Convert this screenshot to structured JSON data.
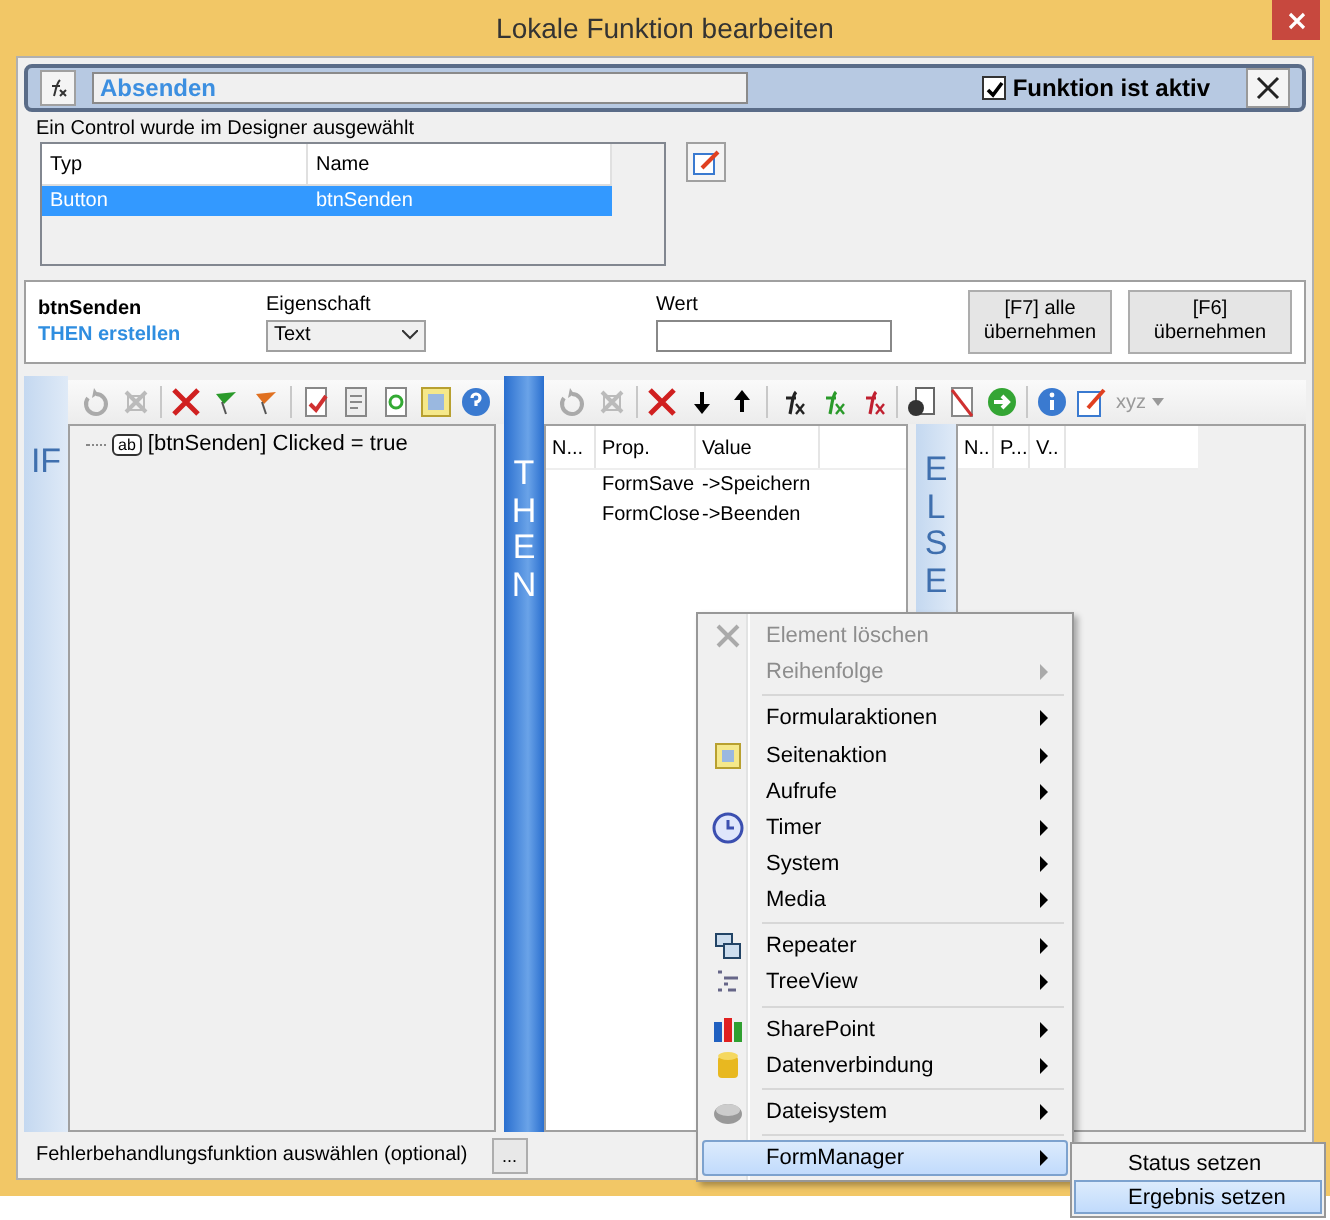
{
  "window": {
    "title": "Lokale Funktion bearbeiten"
  },
  "header": {
    "name": "Absenden",
    "active_label": "Funktion ist aktiv",
    "active": true
  },
  "control_hint": "Ein Control wurde im Designer ausgewählt",
  "controls_table": {
    "columns": [
      "Typ",
      "Name"
    ],
    "rows": [
      {
        "cells": [
          "Button",
          "btnSenden"
        ],
        "selected": true
      }
    ]
  },
  "editor": {
    "control": "btnSenden",
    "mode": "THEN erstellen",
    "property_label": "Eigenschaft",
    "property": "Text",
    "value_label": "Wert",
    "buttons": [
      "[F7] alle übernehmen",
      "[F6] übernehmen"
    ]
  },
  "if_panel": {
    "label": "IF",
    "tree": [
      {
        "badge": "ab",
        "text": "[btnSenden] Clicked = true"
      }
    ]
  },
  "then_panel": {
    "label": "THEN",
    "toolbar_dropdown": "xyz",
    "columns": [
      "N...",
      "Prop.",
      "Value"
    ],
    "rows": [
      [
        "",
        "FormSave",
        "->Speichern"
      ],
      [
        "",
        "FormClose",
        "->Beenden"
      ]
    ]
  },
  "else_panel": {
    "label": "ELSE",
    "columns": [
      "N..",
      "P...",
      "V.."
    ]
  },
  "error_handler": {
    "label": "Fehlerbehandlungsfunktion auswählen (optional)",
    "button": "..."
  },
  "context_menu": {
    "items": [
      {
        "kind": "item",
        "label": "Element löschen",
        "disabled": true,
        "submenu": false,
        "selected": false
      },
      {
        "kind": "item",
        "label": "Reihenfolge",
        "disabled": true,
        "submenu": true,
        "selected": false
      },
      {
        "kind": "separator"
      },
      {
        "kind": "item",
        "label": "Formularaktionen",
        "disabled": false,
        "submenu": true,
        "selected": false
      },
      {
        "kind": "item",
        "label": "Seitenaktion",
        "disabled": false,
        "submenu": true,
        "selected": false
      },
      {
        "kind": "item",
        "label": "Aufrufe",
        "disabled": false,
        "submenu": true,
        "selected": false
      },
      {
        "kind": "item",
        "label": "Timer",
        "disabled": false,
        "submenu": true,
        "selected": false
      },
      {
        "kind": "item",
        "label": "System",
        "disabled": false,
        "submenu": true,
        "selected": false
      },
      {
        "kind": "item",
        "label": "Media",
        "disabled": false,
        "submenu": true,
        "selected": false
      },
      {
        "kind": "separator"
      },
      {
        "kind": "item",
        "label": "Repeater",
        "disabled": false,
        "submenu": true,
        "selected": false
      },
      {
        "kind": "item",
        "label": "TreeView",
        "disabled": false,
        "submenu": true,
        "selected": false
      },
      {
        "kind": "separator"
      },
      {
        "kind": "item",
        "label": "SharePoint",
        "disabled": false,
        "submenu": true,
        "selected": false
      },
      {
        "kind": "item",
        "label": "Datenverbindung",
        "disabled": false,
        "submenu": true,
        "selected": false
      },
      {
        "kind": "separator"
      },
      {
        "kind": "item",
        "label": "Dateisystem",
        "disabled": false,
        "submenu": true,
        "selected": false
      },
      {
        "kind": "separator"
      },
      {
        "kind": "item",
        "label": "FormManager",
        "disabled": false,
        "submenu": true,
        "selected": true
      }
    ]
  },
  "submenu": {
    "items": [
      {
        "label": "Status setzen",
        "selected": false
      },
      {
        "label": "Ergebnis setzen",
        "selected": true
      }
    ]
  }
}
